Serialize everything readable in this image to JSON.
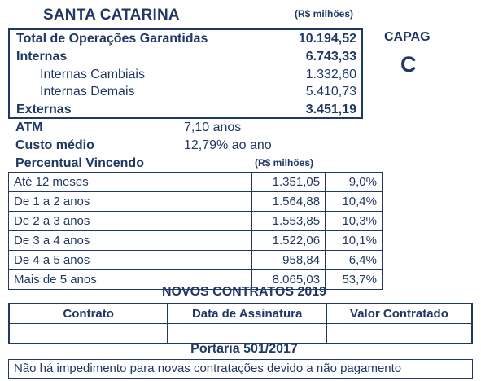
{
  "header": {
    "state": "SANTA CATARINA",
    "unit": "(R$ milhões)"
  },
  "summary": {
    "total_label": "Total de Operações Garantidas",
    "total_value": "10.194,52",
    "internas_label": "Internas",
    "internas_value": "6.743,33",
    "cambiais_label": "Internas Cambiais",
    "cambiais_value": "1.332,60",
    "demais_label": "Internas Demais",
    "demais_value": "5.410,73",
    "externas_label": "Externas",
    "externas_value": "3.451,19"
  },
  "capag": {
    "label": "CAPAG",
    "grade": "C"
  },
  "atm": {
    "label": "ATM",
    "value": "7,10 anos"
  },
  "custo": {
    "label": "Custo médio",
    "value": "12,79% ao ano"
  },
  "vincendo": {
    "label": "Percentual Vincendo",
    "unit": "(R$ milhões)",
    "rows": [
      {
        "label": "Até 12 meses",
        "value": "1.351,05",
        "pct": "9,0%"
      },
      {
        "label": "De 1 a 2 anos",
        "value": "1.564,88",
        "pct": "10,4%"
      },
      {
        "label": "De 2 a 3 anos",
        "value": "1.553,85",
        "pct": "10,3%"
      },
      {
        "label": "De 3 a 4 anos",
        "value": "1.522,06",
        "pct": "10,1%"
      },
      {
        "label": "De 4 a 5 anos",
        "value": "958,84",
        "pct": "6,4%"
      },
      {
        "label": "Mais de 5 anos",
        "value": "8.065,03",
        "pct": "53,7%"
      }
    ]
  },
  "novos": {
    "title": "NOVOS CONTRATOS 2019",
    "col_contrato": "Contrato",
    "col_data": "Data de Assinatura",
    "col_valor": "Valor Contratado"
  },
  "portaria": {
    "title": "Portaria 501/2017",
    "text": "Não há impedimento para novas contratações devido a não pagamento"
  }
}
